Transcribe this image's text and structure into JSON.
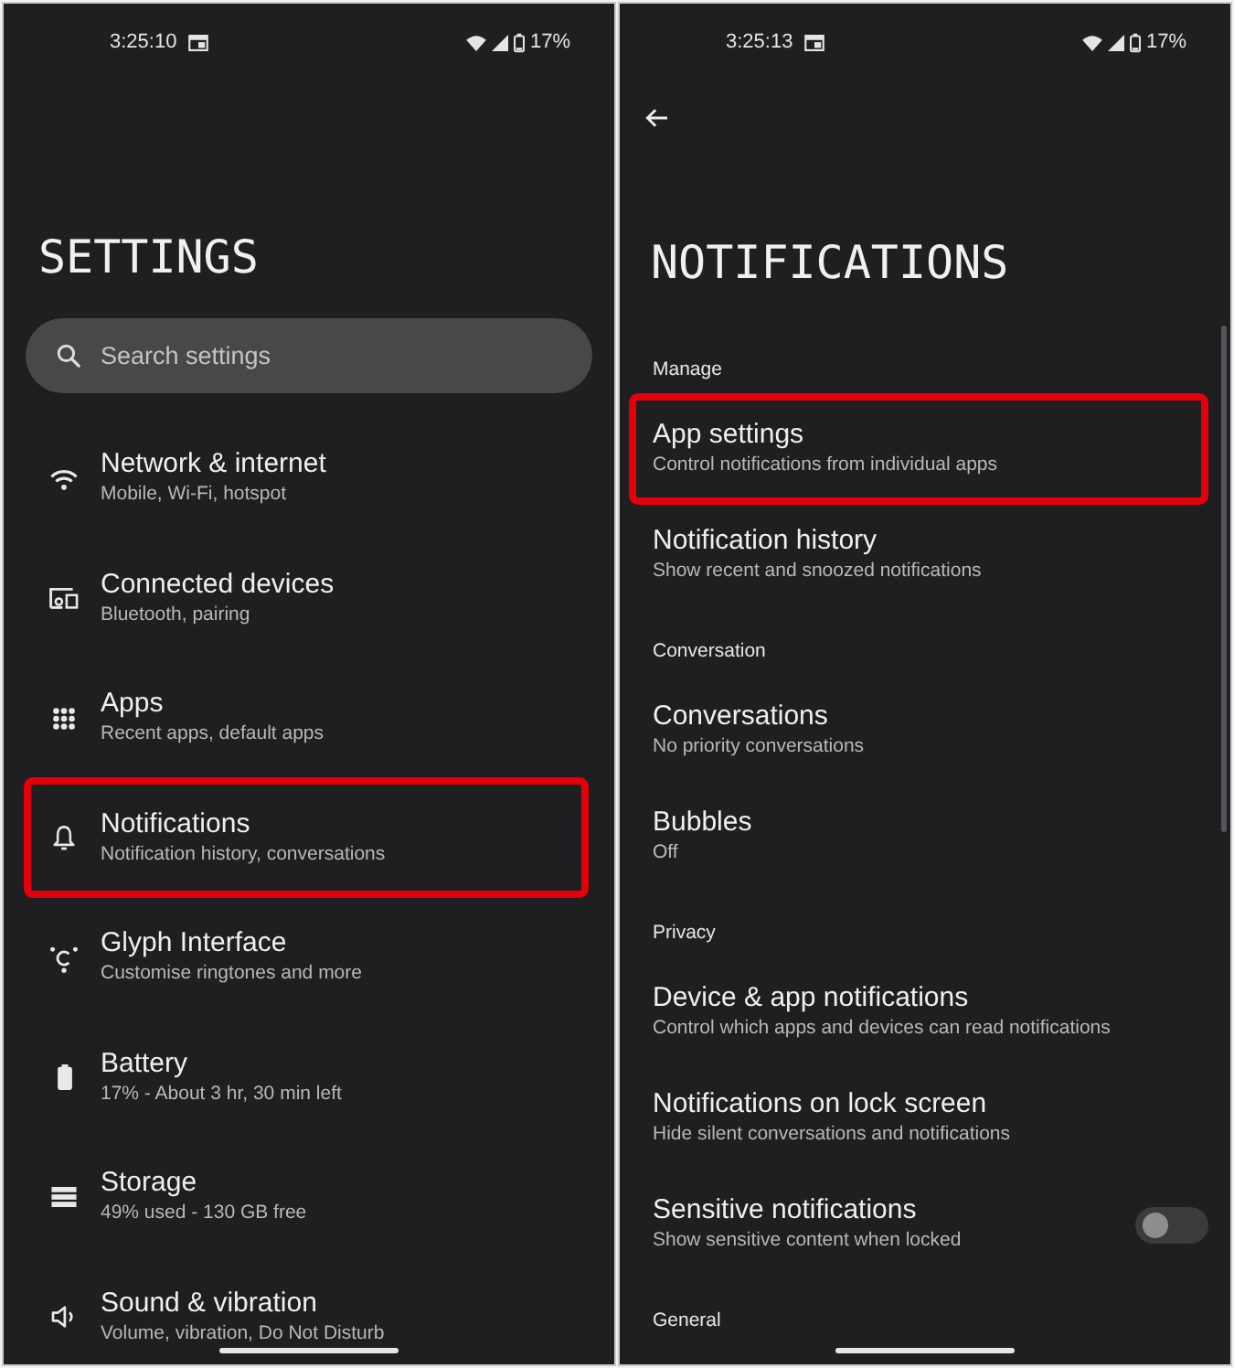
{
  "settings_screen": {
    "status_bar": {
      "time": "3:25:10",
      "battery": "17%"
    },
    "title": "SETTINGS",
    "search": {
      "placeholder": "Search settings"
    },
    "items": [
      {
        "title": "Network & internet",
        "subtitle": "Mobile, Wi-Fi, hotspot",
        "highlighted": false
      },
      {
        "title": "Connected devices",
        "subtitle": "Bluetooth, pairing",
        "highlighted": false
      },
      {
        "title": "Apps",
        "subtitle": "Recent apps, default apps",
        "highlighted": false
      },
      {
        "title": "Notifications",
        "subtitle": "Notification history, conversations",
        "highlighted": true
      },
      {
        "title": "Glyph Interface",
        "subtitle": "Customise ringtones and more",
        "highlighted": false
      },
      {
        "title": "Battery",
        "subtitle": "17% - About 3 hr, 30 min left",
        "highlighted": false
      },
      {
        "title": "Storage",
        "subtitle": "49% used - 130 GB free",
        "highlighted": false
      },
      {
        "title": "Sound & vibration",
        "subtitle": "Volume, vibration, Do Not Disturb",
        "highlighted": false
      }
    ]
  },
  "notifications_screen": {
    "status_bar": {
      "time": "3:25:13",
      "battery": "17%"
    },
    "title": "NOTIFICATIONS",
    "sections": [
      {
        "header": "Manage",
        "items": [
          {
            "kind": "link",
            "title": "App settings",
            "subtitle": "Control notifications from individual apps",
            "highlighted": true
          },
          {
            "kind": "link",
            "title": "Notification history",
            "subtitle": "Show recent and snoozed notifications",
            "highlighted": false
          }
        ]
      },
      {
        "header": "Conversation",
        "items": [
          {
            "kind": "link",
            "title": "Conversations",
            "subtitle": "No priority conversations",
            "highlighted": false
          },
          {
            "kind": "link",
            "title": "Bubbles",
            "subtitle": "Off",
            "highlighted": false
          }
        ]
      },
      {
        "header": "Privacy",
        "items": [
          {
            "kind": "link",
            "title": "Device & app notifications",
            "subtitle": "Control which apps and devices can read notifications",
            "highlighted": false
          },
          {
            "kind": "link",
            "title": "Notifications on lock screen",
            "subtitle": "Hide silent conversations and notifications",
            "highlighted": false
          },
          {
            "kind": "toggle",
            "title": "Sensitive notifications",
            "subtitle": "Show sensitive content when locked",
            "on": false,
            "highlighted": false
          }
        ]
      },
      {
        "header": "General"
      }
    ]
  }
}
